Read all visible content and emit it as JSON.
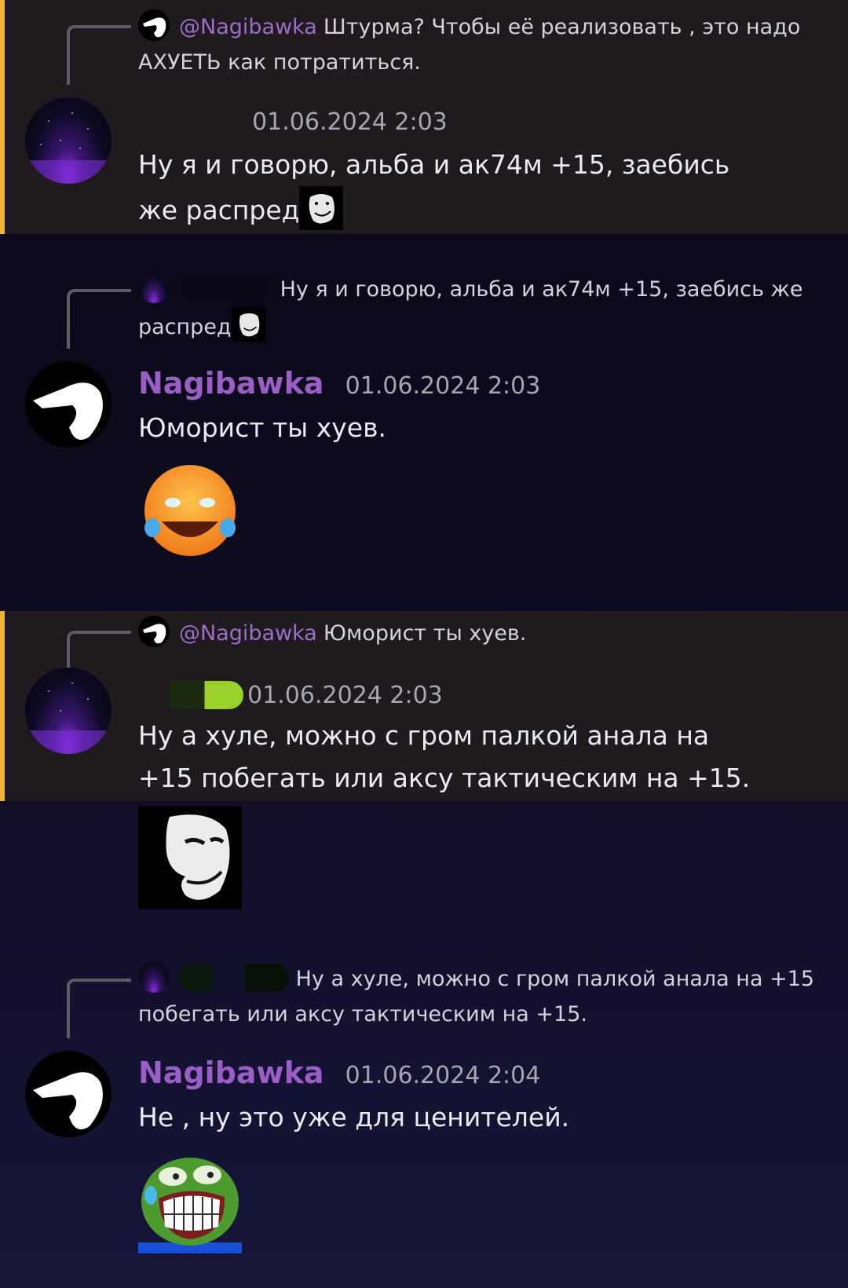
{
  "messages": [
    {
      "reply": {
        "mention": "@Nagibawka",
        "text": "Штурма? Чтобы её реализовать , это надо АХУЕТЬ как потратиться."
      },
      "author": "",
      "time": "01.06.2024 2:03",
      "text": "Ну я и говорю, альба и ак74м +15, заебись же распред"
    },
    {
      "reply": {
        "mention": "",
        "text": "Ну я и говорю, альба и ак74м +15, заебись же распред"
      },
      "author": "Nagibawka",
      "time": "01.06.2024 2:03",
      "text": "Юморист ты хуев."
    },
    {
      "reply": {
        "mention": "@Nagibawka",
        "text": "Юморист ты хуев."
      },
      "author": "",
      "time": "01.06.2024 2:03",
      "text": "Ну а хуле, можно с гром палкой анала на +15 побегать или аксу тактическим на +15."
    },
    {
      "reply": {
        "mention": "",
        "text": "Ну а хуле, можно с гром палкой анала на +15 побегать или аксу тактическим на +15."
      },
      "author": "Nagibawka",
      "time": "01.06.2024 2:04",
      "text": "Не , ну это уже для ценителей."
    }
  ],
  "colors": {
    "highlight_bar": "#f0b232",
    "username": "#9a5fc6",
    "timestamp": "#a7a5b2"
  },
  "icons": {
    "avatar_space": "starfield-avatar-icon",
    "avatar_bird": "white-bird-avatar-icon",
    "sticker_laugh": "laughing-crying-emoji-icon",
    "sticker_troll": "trollface-icon",
    "sticker_pepe": "pepe-laughing-icon"
  }
}
